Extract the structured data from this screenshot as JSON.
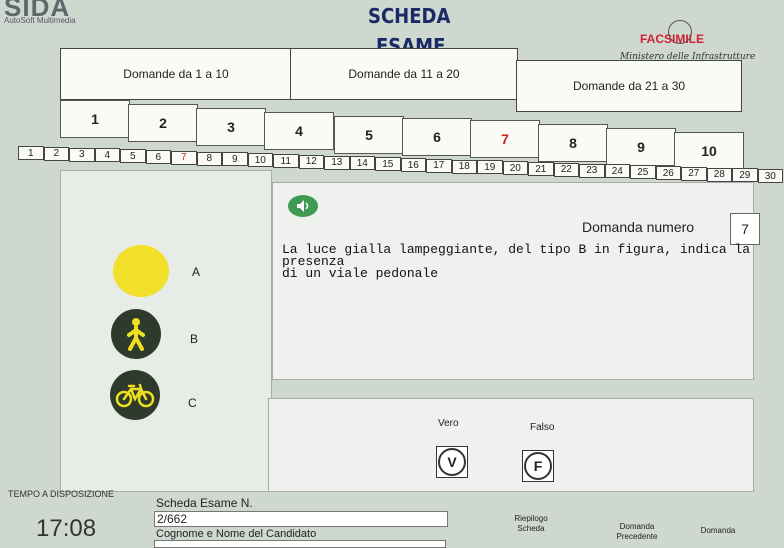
{
  "header": {
    "brand": "SIDA",
    "brand_sub": "AutoSoft Multimedia",
    "title_line1": "SCHEDA",
    "title_line2": "ESAME",
    "facsimile": "FACSIMILE",
    "ministry": "Ministero delle Infrastrutture e dei Trasporti"
  },
  "groups": [
    {
      "label": "Domande da 1 a 10"
    },
    {
      "label": "Domande da 11 a 20"
    },
    {
      "label": "Domande da 21 a 30"
    }
  ],
  "question_buttons": [
    "1",
    "2",
    "3",
    "4",
    "5",
    "6",
    "7",
    "8",
    "9",
    "10"
  ],
  "active_question_button": "7",
  "small_strip": [
    "1",
    "2",
    "3",
    "4",
    "5",
    "6",
    "7",
    "8",
    "9",
    "10",
    "11",
    "12",
    "13",
    "14",
    "15",
    "16",
    "17",
    "18",
    "19",
    "20",
    "21",
    "22",
    "23",
    "24",
    "25",
    "26",
    "27",
    "28",
    "29",
    "30"
  ],
  "question": {
    "label": "Domanda numero",
    "number": "7",
    "text_line1": "La luce gialla lampeggiante, del tipo B in figura, indica la presenza",
    "text_line2": "di un viale pedonale"
  },
  "options": {
    "a": "A",
    "b": "B",
    "c": "C"
  },
  "answers": {
    "true_label": "Vero",
    "false_label": "Falso",
    "true_glyph": "V",
    "false_glyph": "F"
  },
  "footer": {
    "time_label": "TEMPO A DISPOSIZIONE",
    "time_value": "17:08",
    "scheda_label": "Scheda Esame N.",
    "scheda_value": "2/662",
    "candidate_label": "Cognome e Nome del Candidato",
    "riepilogo_line1": "Riepilogo",
    "riepilogo_line2": "Scheda",
    "prev_line1": "Domanda",
    "prev_line2": "Precedente",
    "next_line1": "Domanda"
  },
  "colors": {
    "yellow_light": "#f2df2a",
    "dark_circle": "#2d3a2c",
    "active_red": "#cc2222",
    "speaker_green": "#3f9a52"
  }
}
